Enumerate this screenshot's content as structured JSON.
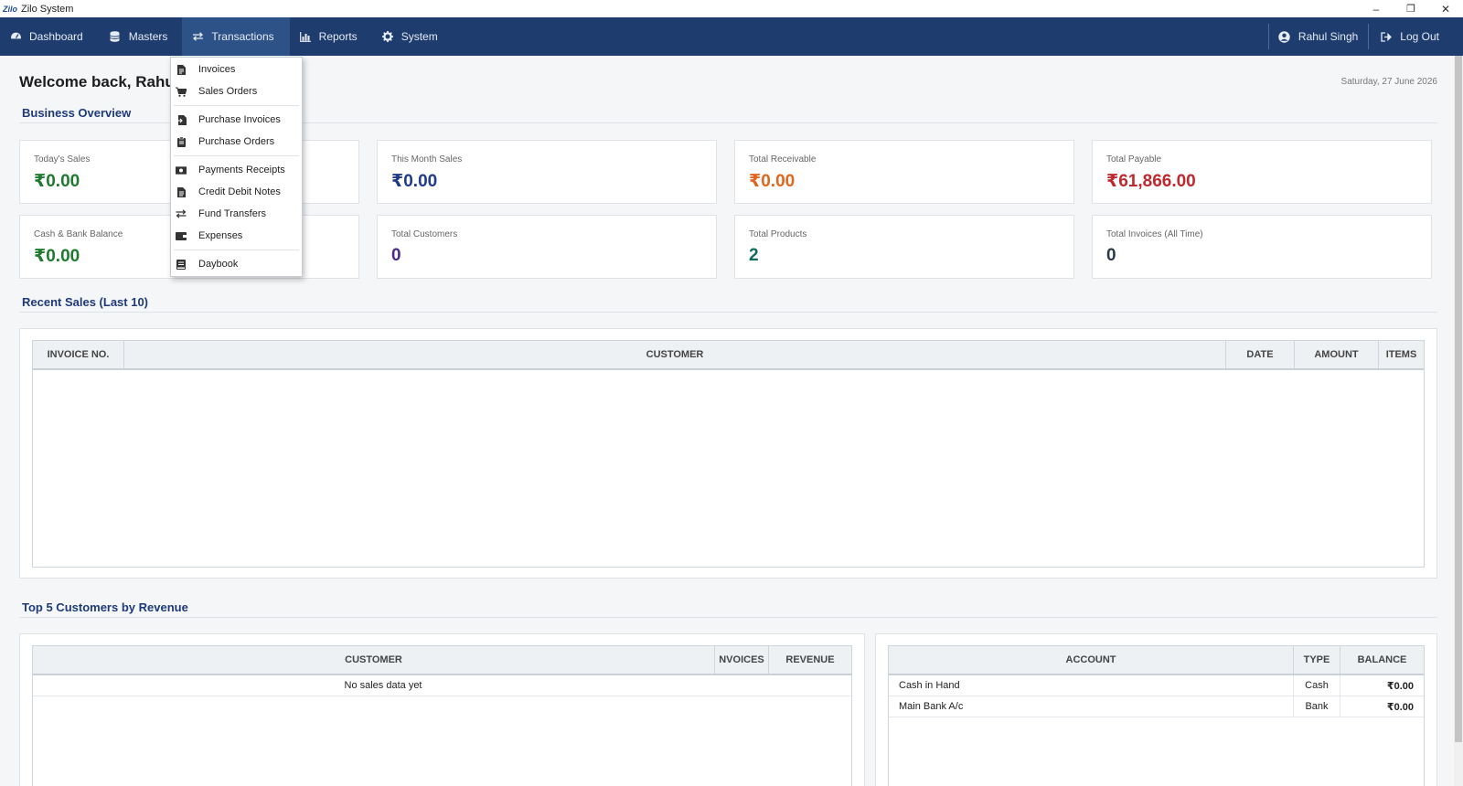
{
  "window": {
    "logo_text": "Zilo",
    "title": "Zilo System",
    "minimize": "–",
    "restore": "❐",
    "close": "✕"
  },
  "nav": {
    "items": [
      {
        "label": "Dashboard",
        "icon": "dashboard-icon"
      },
      {
        "label": "Masters",
        "icon": "database-icon"
      },
      {
        "label": "Transactions",
        "icon": "exchange-icon"
      },
      {
        "label": "Reports",
        "icon": "bar-chart-icon"
      },
      {
        "label": "System",
        "icon": "gear-icon"
      }
    ],
    "user": "Rahul Singh",
    "logout": "Log Out"
  },
  "transactions_menu": {
    "items": [
      {
        "label": "Invoices",
        "icon": "document-icon"
      },
      {
        "label": "Sales Orders",
        "icon": "cart-icon"
      },
      {
        "label": "Purchase Invoices",
        "icon": "import-document-icon"
      },
      {
        "label": "Purchase Orders",
        "icon": "clipboard-icon"
      },
      {
        "label": "Payments  Receipts",
        "icon": "money-icon"
      },
      {
        "label": "Credit  Debit Notes",
        "icon": "note-icon"
      },
      {
        "label": "Fund Transfers",
        "icon": "exchange-icon"
      },
      {
        "label": "Expenses",
        "icon": "wallet-icon"
      },
      {
        "label": "Daybook",
        "icon": "book-icon"
      }
    ]
  },
  "header": {
    "welcome": "Welcome back, Rahul",
    "date": "Saturday, 27 June 2026"
  },
  "overview": {
    "title": "Business Overview",
    "cards": [
      {
        "label": "Today's Sales",
        "value": "₹0.00",
        "color": "#1e7a2e"
      },
      {
        "label": "This Month Sales",
        "value": "₹0.00",
        "color": "#1e3a8a"
      },
      {
        "label": "Total Receivable",
        "value": "₹0.00",
        "color": "#e0661c"
      },
      {
        "label": "Total Payable",
        "value": "₹61,866.00",
        "color": "#c0282d"
      },
      {
        "label": "Cash & Bank Balance",
        "value": "₹0.00",
        "color": "#1e7a2e"
      },
      {
        "label": "Total Customers",
        "value": "0",
        "color": "#4a2a8a"
      },
      {
        "label": "Total Products",
        "value": "2",
        "color": "#0f6b5e"
      },
      {
        "label": "Total Invoices (All Time)",
        "value": "0",
        "color": "#2b3a4a"
      }
    ]
  },
  "recent_sales": {
    "title": "Recent Sales (Last 10)",
    "columns": [
      "INVOICE NO.",
      "CUSTOMER",
      "DATE",
      "AMOUNT",
      "ITEMS"
    ]
  },
  "top_customers": {
    "title": "Top 5 Customers by Revenue",
    "columns": [
      "CUSTOMER",
      "NVOICES",
      "REVENUE"
    ],
    "empty_text": "No sales data yet"
  },
  "accounts": {
    "columns": [
      "ACCOUNT",
      "TYPE",
      "BALANCE"
    ],
    "rows": [
      {
        "account": "Cash in Hand",
        "type": "Cash",
        "balance": "₹0.00"
      },
      {
        "account": "Main Bank A/c",
        "type": "Bank",
        "balance": "₹0.00"
      }
    ]
  },
  "colors": {
    "navbar": "#1e3c6e",
    "nav_active": "#2d5288",
    "section_title": "#1e3a7a"
  }
}
